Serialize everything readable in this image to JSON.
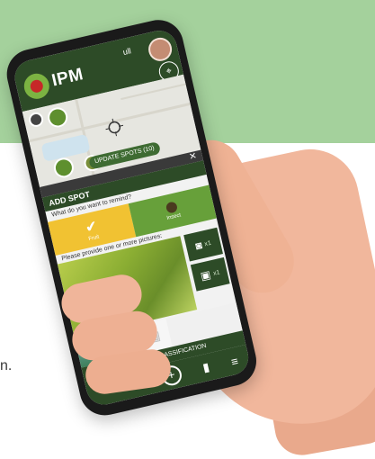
{
  "background": {
    "stray_char": "g",
    "body_fragment": "n."
  },
  "app": {
    "title": "IPM",
    "signal": "ull"
  },
  "map": {
    "upload_pill": "UPDATE SPOTS (10)",
    "close_icon": "✕"
  },
  "add_spot": {
    "title": "ADD SPOT",
    "question_reminder": "What do you want to remind?",
    "choice_yes": "Fruit",
    "choice_insect": "Insect",
    "question_pictures": "Please provide one or more pictures:",
    "camera_count": "x1",
    "gallery_count": "x1"
  },
  "actions": {
    "send_ai": "SEND TO AI CLASSIFICATION"
  }
}
